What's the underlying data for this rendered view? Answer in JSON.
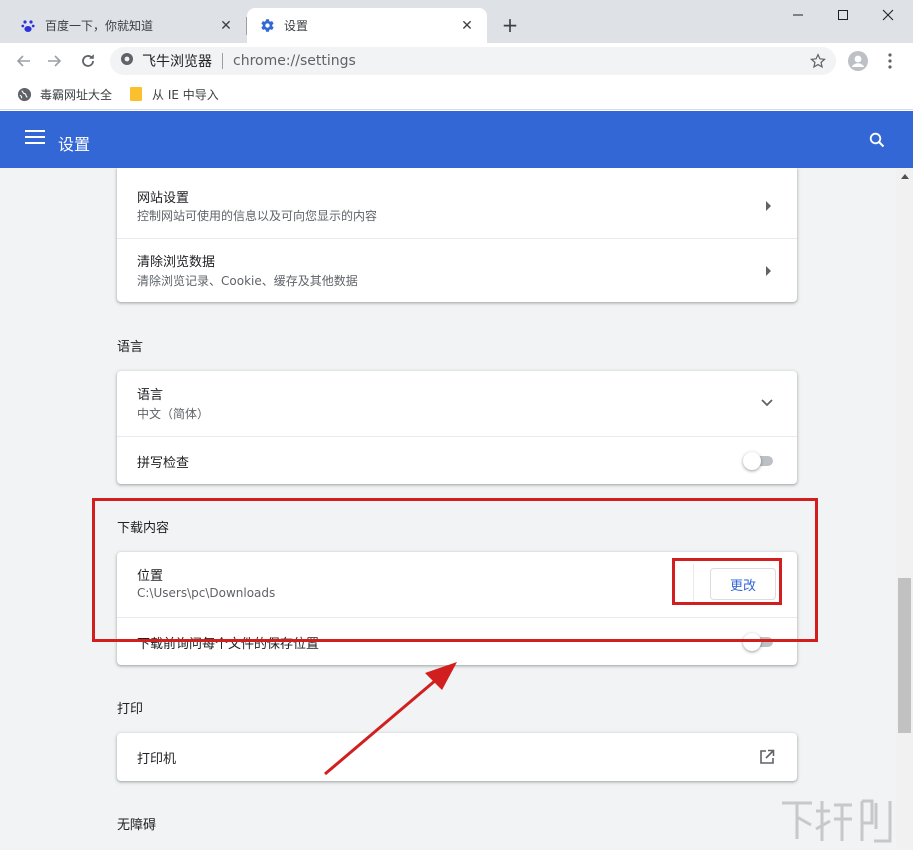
{
  "tabs": [
    {
      "title": "百度一下，你就知道",
      "icon": "baidu-paw-icon"
    },
    {
      "title": "设置",
      "icon": "gear-icon"
    }
  ],
  "omnibox": {
    "site_name": "飞牛浏览器",
    "url": "chrome://settings"
  },
  "bookmarks": [
    {
      "label": "毒霸网址大全",
      "icon": "globe-icon"
    },
    {
      "label": "从 IE 中导入",
      "icon": "folder-icon"
    }
  ],
  "header": {
    "title": "设置"
  },
  "privacy_card": {
    "rows": [
      {
        "title": "网站设置",
        "subtitle": "控制网站可使用的信息以及可向您显示的内容"
      },
      {
        "title": "清除浏览数据",
        "subtitle": "清除浏览记录、Cookie、缓存及其他数据"
      }
    ]
  },
  "language": {
    "section_title": "语言",
    "rows": [
      {
        "title": "语言",
        "subtitle": "中文（简体）"
      },
      {
        "title": "拼写检查",
        "toggle_on": false
      }
    ]
  },
  "downloads": {
    "section_title": "下载内容",
    "location_title": "位置",
    "location_path": "C:\\Users\\pc\\Downloads",
    "change_label": "更改",
    "ask_label": "下载前询问每个文件的保存位置",
    "ask_toggle_on": false
  },
  "print": {
    "section_title": "打印",
    "printer_label": "打印机"
  },
  "accessibility": {
    "section_title": "无障碍"
  },
  "colors": {
    "accent": "#3367d6",
    "annotation": "#d11f1f"
  }
}
